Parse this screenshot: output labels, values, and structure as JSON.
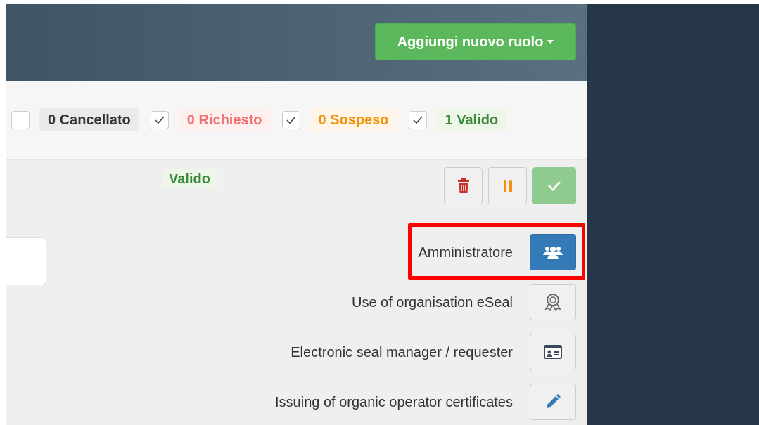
{
  "header": {
    "add_button": {
      "label": "Aggiungi nuovo ruolo"
    }
  },
  "filters": [
    {
      "kind": "cancelled",
      "checked": false,
      "label": "0 Cancellato"
    },
    {
      "kind": "requested",
      "checked": true,
      "label": "0 Richiesto"
    },
    {
      "kind": "suspended",
      "checked": true,
      "label": "0 Sospeso"
    },
    {
      "kind": "valid",
      "checked": true,
      "label": "1 Valido"
    }
  ],
  "status_badge": "Valido",
  "actions": [
    {
      "kind": "delete",
      "disabled": false
    },
    {
      "kind": "suspend",
      "disabled": false
    },
    {
      "kind": "validate",
      "disabled": true
    }
  ],
  "roles": [
    {
      "label": "Amministratore",
      "kind": "people",
      "selected": true,
      "highlighted": true
    },
    {
      "label": "Use of organisation eSeal",
      "kind": "award",
      "selected": false,
      "highlighted": false
    },
    {
      "label": "Electronic seal manager / requester",
      "kind": "idcard",
      "selected": false,
      "highlighted": false
    },
    {
      "label": "Issuing of organic operator certificates",
      "kind": "pencil",
      "selected": false,
      "highlighted": false
    }
  ]
}
